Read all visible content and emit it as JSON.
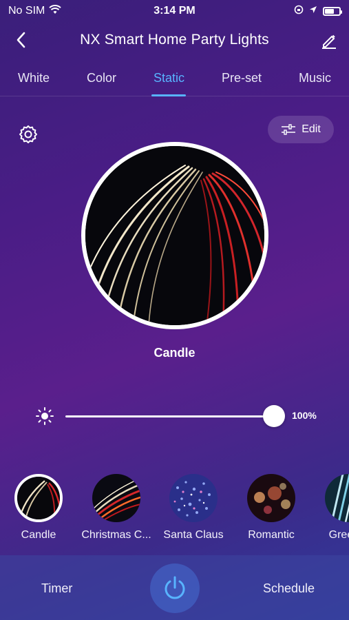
{
  "status_bar": {
    "carrier": "No SIM",
    "time": "3:14 PM"
  },
  "header": {
    "title": "NX Smart Home Party Lights"
  },
  "tabs": [
    {
      "label": "White",
      "active": false
    },
    {
      "label": "Color",
      "active": false
    },
    {
      "label": "Static",
      "active": true
    },
    {
      "label": "Pre-set",
      "active": false
    },
    {
      "label": "Music",
      "active": false
    }
  ],
  "edit_button": {
    "label": "Edit"
  },
  "current_scene": {
    "name": "Candle"
  },
  "brightness": {
    "value_label": "100%",
    "level": 1.0
  },
  "scenes": [
    {
      "label": "Candle",
      "selected": true
    },
    {
      "label": "Christmas C...",
      "selected": false
    },
    {
      "label": "Santa Claus",
      "selected": false
    },
    {
      "label": "Romantic",
      "selected": false
    },
    {
      "label": "Green F",
      "selected": false
    }
  ],
  "bottom_bar": {
    "timer_label": "Timer",
    "schedule_label": "Schedule"
  },
  "colors": {
    "accent": "#58b4ff",
    "background": "#4a1d86"
  }
}
